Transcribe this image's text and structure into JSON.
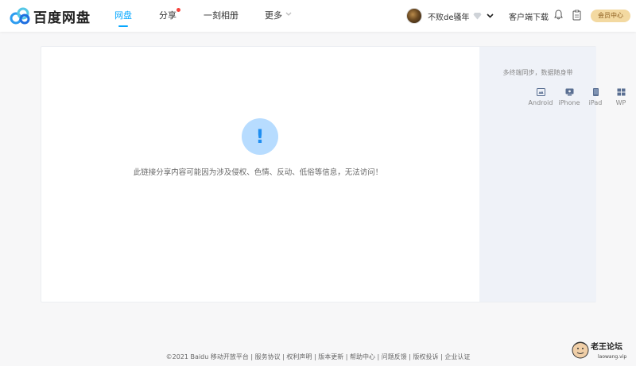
{
  "header": {
    "logo_text": "百度网盘",
    "nav": [
      {
        "label": "网盘",
        "active": true
      },
      {
        "label": "分享",
        "active": false,
        "has_dot": true
      },
      {
        "label": "一刻相册",
        "active": false
      },
      {
        "label": "更多",
        "active": false,
        "has_caret": true
      }
    ],
    "username": "不败de骚年",
    "client_download": "客户端下载",
    "vip_label": "会员中心"
  },
  "main": {
    "alert_symbol": "!",
    "error_message": "此链接分享内容可能因为涉及侵权、色情、反动、低俗等信息，无法访问！"
  },
  "side": {
    "title": "多终端同步，数据随身带",
    "platforms": [
      {
        "label": "Android",
        "icon": "android-icon"
      },
      {
        "label": "iPhone",
        "icon": "iphone-icon"
      },
      {
        "label": "iPad",
        "icon": "ipad-icon"
      },
      {
        "label": "WP",
        "icon": "windows-phone-icon"
      }
    ]
  },
  "footer": {
    "text": "©2021 Baidu  移动开放平台 | 服务协议 | 权利声明 | 版本更新 | 帮助中心 | 问题反馈 | 版权投诉 | 企业认证"
  },
  "watermark": {
    "name": "老王论坛",
    "url": "laowang.vip"
  },
  "colors": {
    "accent": "#06a7ff",
    "alert_bg": "#b7dcff",
    "vip_bg": "#f3d9a1",
    "notification_dot": "#f5423c"
  }
}
